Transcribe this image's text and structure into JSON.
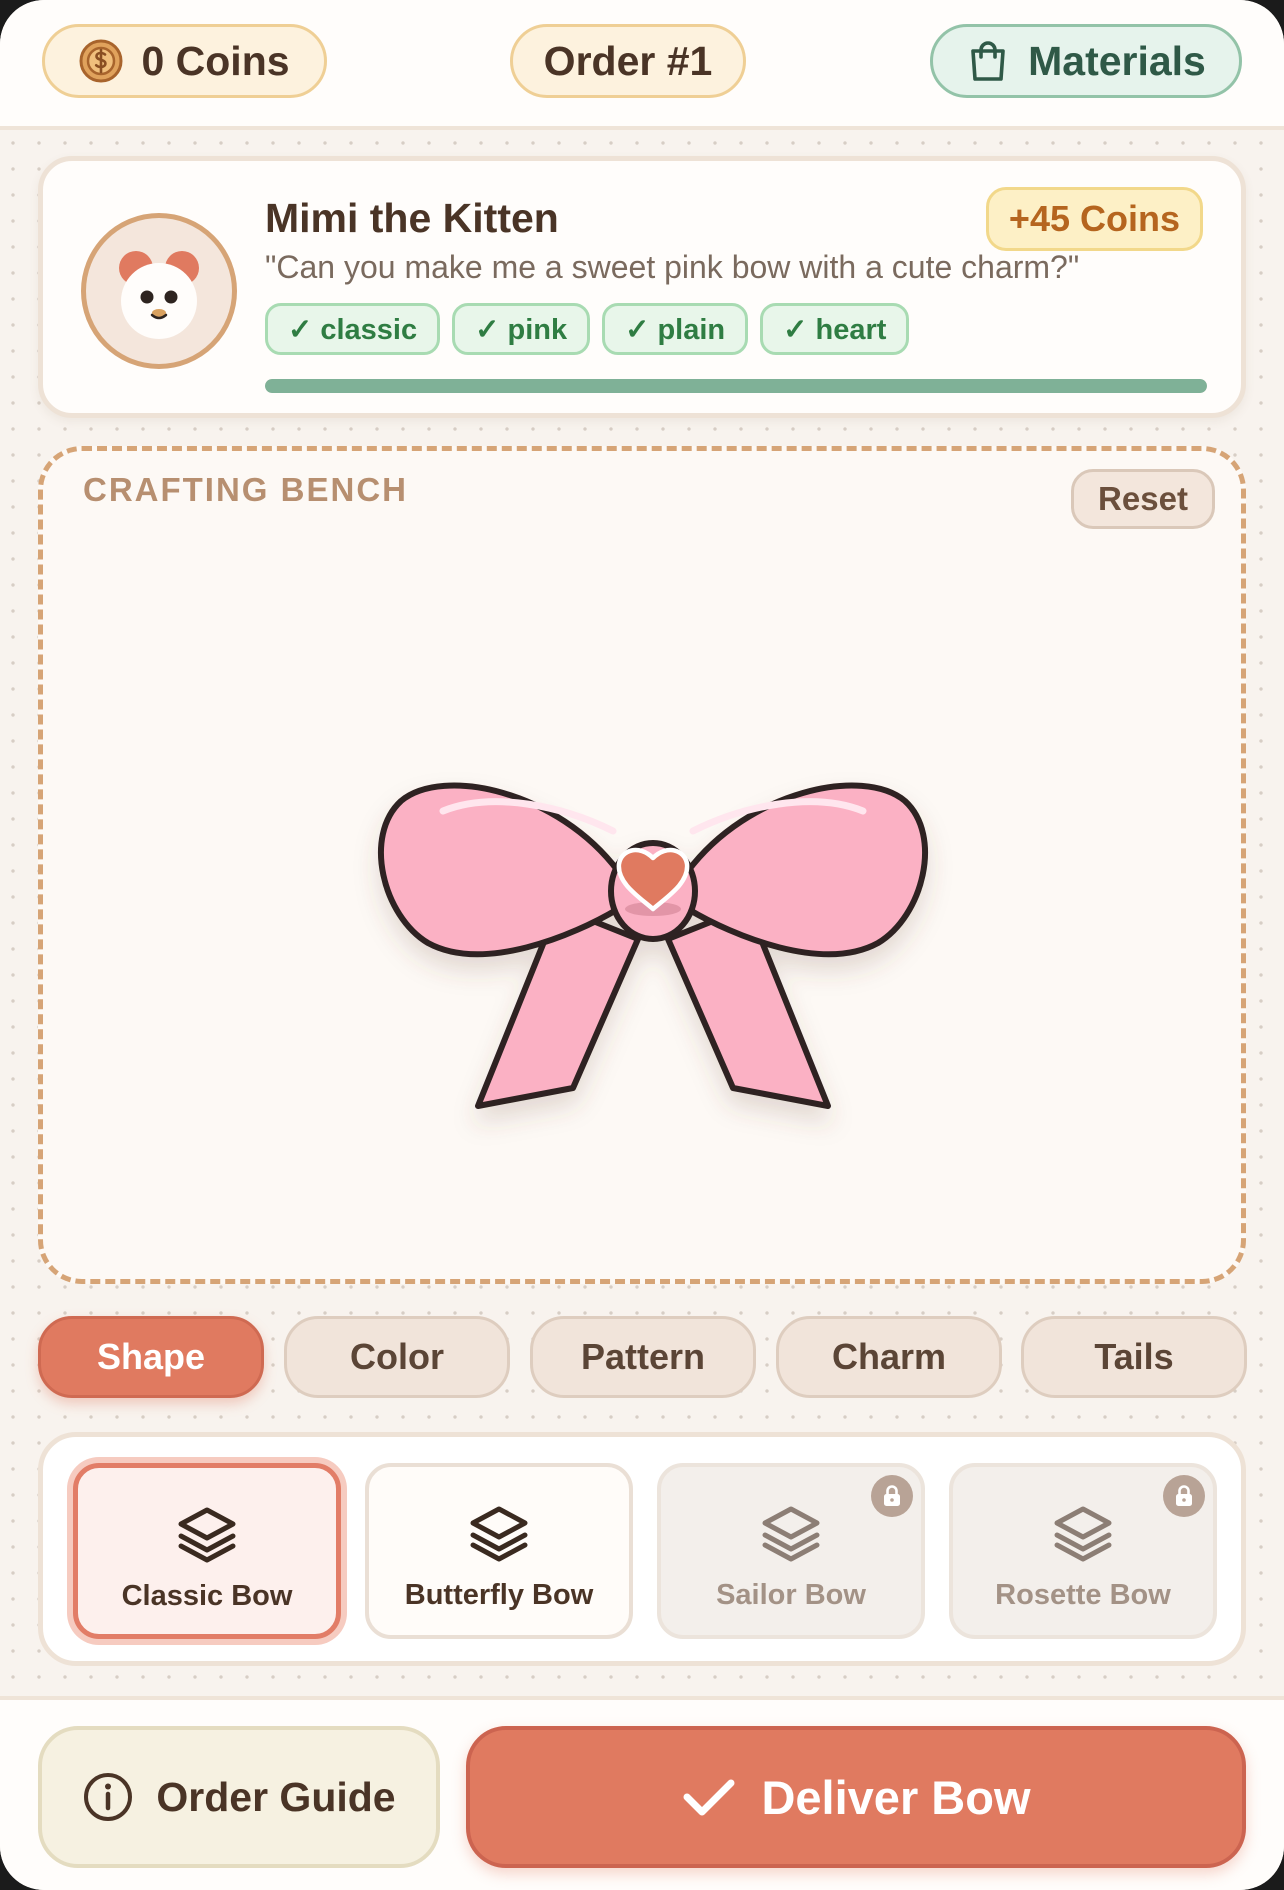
{
  "header": {
    "coins_label": "0 Coins",
    "order_label": "Order #1",
    "materials_label": "Materials"
  },
  "customer": {
    "name": "Mimi the Kitten",
    "reward": "+45 Coins",
    "quote": "\"Can you make me a sweet pink bow with a cute charm?\"",
    "requirements": [
      "✓ classic",
      "✓ pink",
      "✓ plain",
      "✓ heart"
    ],
    "progress": 1.0
  },
  "bench": {
    "label": "CRAFTING BENCH",
    "reset_label": "Reset",
    "bow": {
      "shape": "classic",
      "color": "#fbb1c4",
      "pattern": "plain",
      "charm": "heart",
      "charm_color": "#e07a60"
    }
  },
  "tabs": [
    {
      "label": "Shape",
      "active": true
    },
    {
      "label": "Color",
      "active": false
    },
    {
      "label": "Pattern",
      "active": false
    },
    {
      "label": "Charm",
      "active": false
    },
    {
      "label": "Tails",
      "active": false
    }
  ],
  "options": [
    {
      "label": "Classic Bow",
      "icon": "layers-icon",
      "selected": true,
      "locked": false
    },
    {
      "label": "Butterfly Bow",
      "icon": "layers-icon",
      "selected": false,
      "locked": false
    },
    {
      "label": "Sailor Bow",
      "icon": "layers-icon",
      "selected": false,
      "locked": true
    },
    {
      "label": "Rosette Bow",
      "icon": "layers-icon",
      "selected": false,
      "locked": true
    }
  ],
  "footer": {
    "guide_label": "Order Guide",
    "deliver_label": "Deliver Bow"
  },
  "colors": {
    "accent": "#e07a60",
    "success": "#2f7d43",
    "brown": "#4a3426"
  }
}
